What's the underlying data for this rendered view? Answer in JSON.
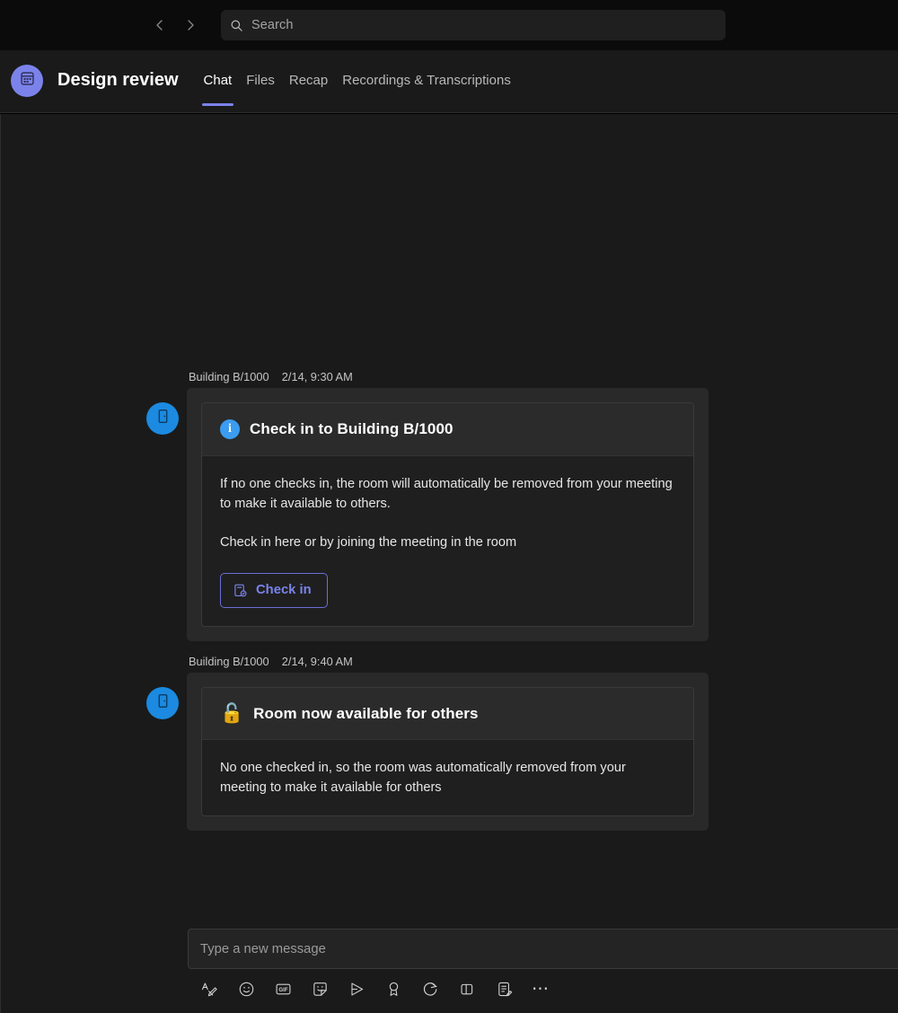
{
  "titlebar": {
    "back_icon": "chevron-left-icon",
    "forward_icon": "chevron-right-icon",
    "search": {
      "icon": "search-icon",
      "placeholder": "Search",
      "value": ""
    }
  },
  "meeting_header": {
    "avatar_icon": "calendar-icon",
    "avatar_color": "#7b83eb",
    "title": "Design review",
    "tabs": [
      {
        "label": "Chat",
        "active": true
      },
      {
        "label": "Files",
        "active": false
      },
      {
        "label": "Recap",
        "active": false
      },
      {
        "label": "Recordings & Transcriptions",
        "active": false
      }
    ],
    "active_tab_color": "#7b83eb"
  },
  "messages": [
    {
      "sender": "Building B/1000",
      "timestamp": "2/14, 9:30 AM",
      "avatar_icon": "door-icon",
      "avatar_color": "#1b8ae0",
      "card": {
        "header_icon": "info-circle-icon",
        "header_icon_glyph": "i",
        "header_icon_color": "#3b9cf0",
        "title": "Check in to Building B/1000",
        "paragraphs": [
          "If no one checks in, the room will automatically be removed from your meeting to make it available to others.",
          "Check in here or by joining the meeting in the room"
        ],
        "button": {
          "label": "Check in",
          "icon": "calendar-checkin-icon",
          "color": "#7b83eb"
        }
      }
    },
    {
      "sender": "Building B/1000",
      "timestamp": "2/14, 9:40 AM",
      "avatar_icon": "door-icon",
      "avatar_color": "#1b8ae0",
      "card": {
        "header_icon": "unlock-emoji-icon",
        "header_icon_glyph": "🔓",
        "title": "Room now available for others",
        "paragraphs": [
          "No one checked in, so the room was automatically removed from your meeting to make it available for others"
        ]
      }
    }
  ],
  "composer": {
    "placeholder": "Type a new message",
    "value": "",
    "tools": [
      {
        "name": "format-text-icon",
        "label": "Format"
      },
      {
        "name": "emoji-icon",
        "label": "Emoji"
      },
      {
        "name": "gif-icon",
        "label": "Giphy"
      },
      {
        "name": "sticker-icon",
        "label": "Sticker"
      },
      {
        "name": "send-plane-icon",
        "label": "Stream"
      },
      {
        "name": "praise-badge-icon",
        "label": "Praise"
      },
      {
        "name": "loop-icon",
        "label": "Loop components"
      },
      {
        "name": "poll-icon",
        "label": "Polls"
      },
      {
        "name": "forms-icon",
        "label": "Forms"
      },
      {
        "name": "more-options-icon",
        "label": "More options"
      }
    ]
  }
}
